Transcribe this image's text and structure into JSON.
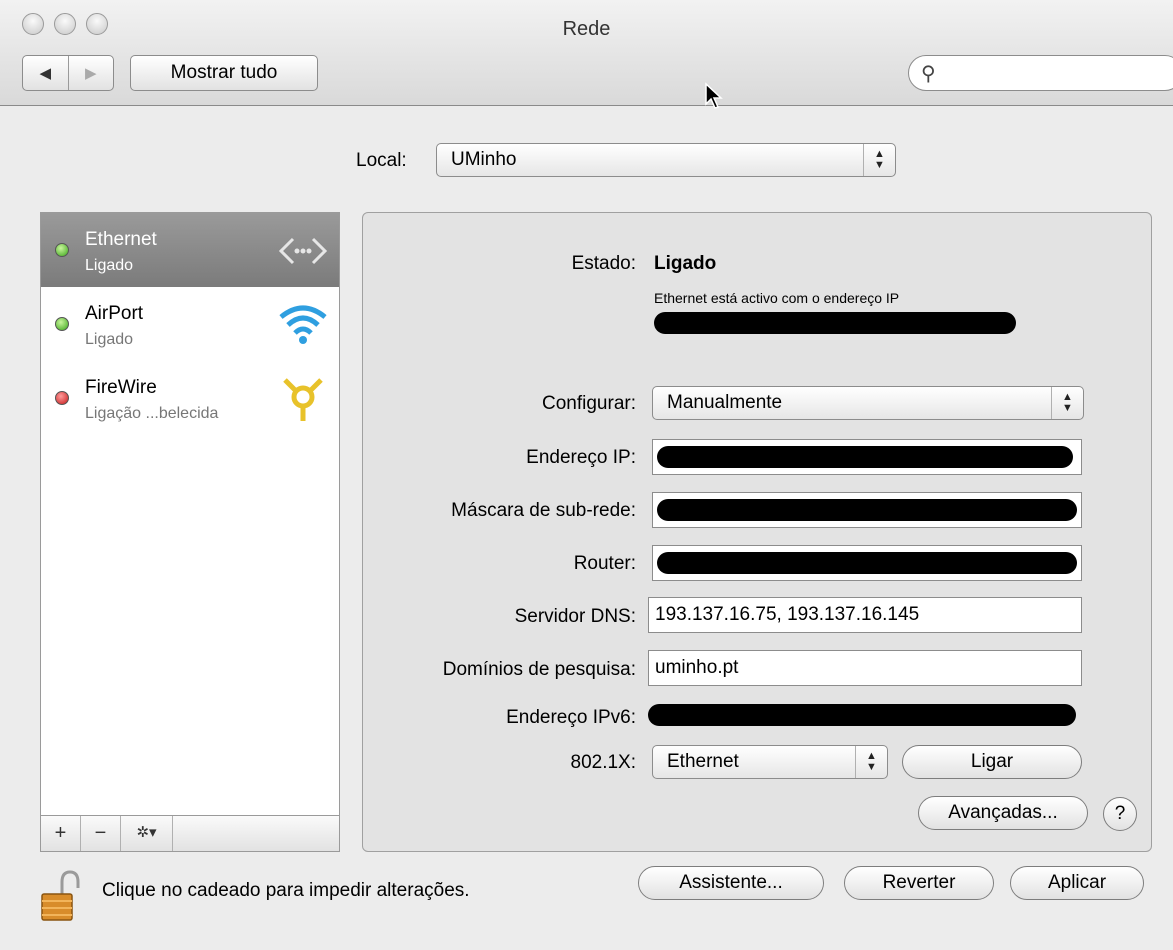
{
  "window": {
    "title": "Rede",
    "nav_back": "◀",
    "nav_forward": "▶",
    "show_all": "Mostrar tudo",
    "search_placeholder": "",
    "search_icon": "search-icon"
  },
  "location": {
    "label": "Local:",
    "value": "UMinho"
  },
  "services": [
    {
      "name": "Ethernet",
      "status": "Ligado",
      "dot": "green",
      "icon": "ethernet-icon",
      "selected": true
    },
    {
      "name": "AirPort",
      "status": "Ligado",
      "dot": "green",
      "icon": "wifi-icon",
      "selected": false
    },
    {
      "name": "FireWire",
      "status": "Ligação ...belecida",
      "dot": "red",
      "icon": "firewire-icon",
      "selected": false
    }
  ],
  "sidebar_actions": {
    "add": "+",
    "remove": "−",
    "action": "✲▾"
  },
  "detail": {
    "status_label": "Estado:",
    "status_value": "Ligado",
    "status_note": "Ethernet está activo com o endereço IP",
    "configure_label": "Configurar:",
    "configure_value": "Manualmente",
    "ip_label": "Endereço IP:",
    "subnet_label": "Máscara de sub-rede:",
    "router_label": "Router:",
    "dns_label": "Servidor DNS:",
    "dns_value": "193.137.16.75, 193.137.16.145",
    "search_domains_label": "Domínios de pesquisa:",
    "search_domains_value": "uminho.pt",
    "ipv6_label": "Endereço IPv6:",
    "dot1x_label": "802.1X:",
    "dot1x_value": "Ethernet",
    "connect_button": "Ligar",
    "advanced_button": "Avançadas...",
    "help_button": "?"
  },
  "footer": {
    "lock_text": "Clique no cadeado para impedir alterações.",
    "assistant_button": "Assistente...",
    "revert_button": "Reverter",
    "apply_button": "Aplicar"
  }
}
